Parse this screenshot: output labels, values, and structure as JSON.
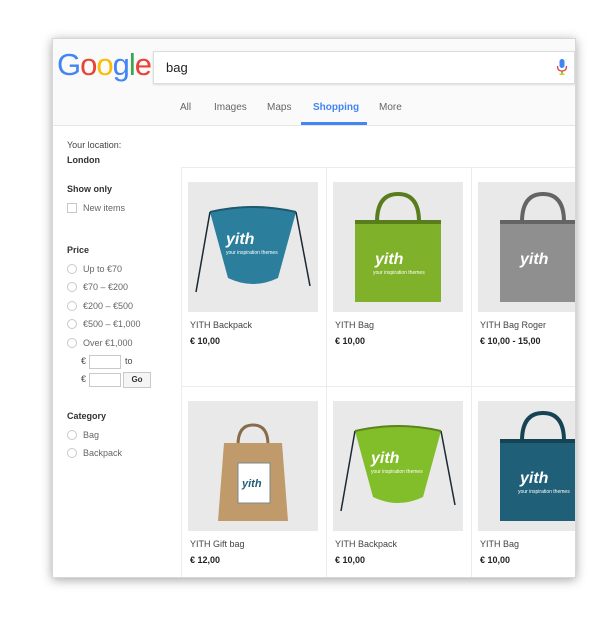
{
  "logo": {
    "letters": [
      "G",
      "o",
      "o",
      "g",
      "l",
      "e"
    ],
    "colors": [
      "#4285f4",
      "#ea4335",
      "#fbbc05",
      "#4285f4",
      "#34a853",
      "#ea4335"
    ]
  },
  "search": {
    "query": "bag"
  },
  "tabs": [
    "All",
    "Images",
    "Maps",
    "Shopping",
    "More"
  ],
  "active_tab": "Shopping",
  "sidebar": {
    "location_label": "Your location:",
    "location_value": "London",
    "show_only_heading": "Show only",
    "new_items": "New items",
    "price_heading": "Price",
    "price_options": [
      "Up to €70",
      "€70 – €200",
      "€200 – €500",
      "€500 – €1,000",
      "Over €1,000"
    ],
    "currency_symbol": "€",
    "to_label": "to",
    "go_label": "Go",
    "category_heading": "Category",
    "category_options": [
      "Bag",
      "Backpack"
    ]
  },
  "products": [
    {
      "name": "YITH Backpack",
      "price": "€ 10,00",
      "color": "#2b7f9c",
      "shape": "backpack",
      "brand": "yith",
      "tagline": "your inspiration themes"
    },
    {
      "name": "YITH Bag",
      "price": "€ 10,00",
      "color": "#7fb22a",
      "shape": "tote",
      "brand": "yith",
      "tagline": "your inspiration themes"
    },
    {
      "name": "YITH Bag Roger",
      "price": "€ 10,00 - 15,00",
      "color": "#8f8f8f",
      "shape": "tote",
      "brand": "yith",
      "tagline": ""
    },
    {
      "name": "YITH Gift bag",
      "price": "€ 12,00",
      "color": "#c19a6b",
      "shape": "paper",
      "brand": "yith",
      "tagline": ""
    },
    {
      "name": "YITH Backpack",
      "price": "€ 10,00",
      "color": "#82bd2a",
      "shape": "backpack",
      "brand": "yith",
      "tagline": "your inspiration themes"
    },
    {
      "name": "YITH Bag",
      "price": "€ 10,00",
      "color": "#1f5f78",
      "shape": "tote",
      "brand": "yith",
      "tagline": "your inspiration themes"
    }
  ],
  "colors": {
    "accent": "#4285f4"
  }
}
